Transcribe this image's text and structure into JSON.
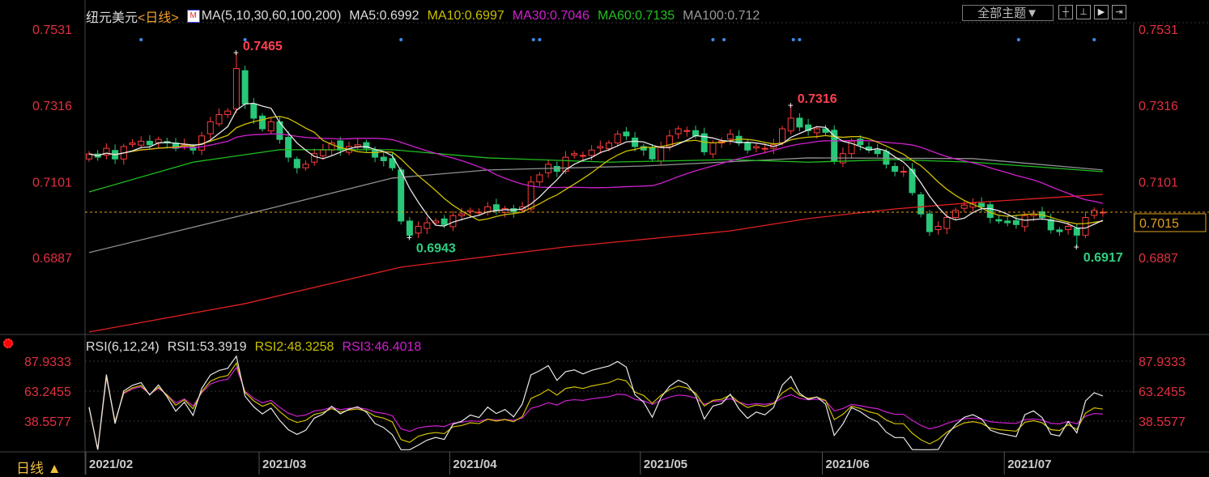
{
  "header": {
    "symbol": "纽元美元",
    "period": "<日线>",
    "ma_label": "MA(5,10,30,60,100,200)",
    "ma5": "MA5:0.6992",
    "ma10": "MA10:0.6997",
    "ma30": "MA30:0.7046",
    "ma60": "MA60:0.7135",
    "ma100": "MA100:0.712",
    "theme_button": "全部主题▼"
  },
  "toolbar_icons": [
    "crosshair-icon",
    "zoom-range-icon",
    "play-icon",
    "move-right-icon"
  ],
  "rsi_header": {
    "label": "RSI(6,12,24)",
    "rsi1": "RSI1:53.3919",
    "rsi2": "RSI2:48.3258",
    "rsi3": "RSI3:46.4018"
  },
  "timeframe": "日线 ▲",
  "colors": {
    "up": "#ff3b3b",
    "down": "#28c878",
    "ma5": "#e8e8e8",
    "ma10": "#d0c000",
    "ma30": "#d020d0",
    "ma60": "#20c020",
    "ma100": "#909090",
    "ma200": "#e02020",
    "axis": "#e03040",
    "last": "#e0a020"
  },
  "chart_data": {
    "type": "candlestick",
    "price_ticks": [
      "0.7531",
      "0.7316",
      "0.7101",
      "0.6887"
    ],
    "price_range": [
      0.6672,
      0.7531
    ],
    "rsi_ticks": [
      "87.9333",
      "63.2455",
      "38.5577"
    ],
    "rsi_range": [
      15,
      95
    ],
    "date_labels": [
      {
        "label": "2021/02",
        "index": 0
      },
      {
        "label": "2021/03",
        "index": 20
      },
      {
        "label": "2021/04",
        "index": 42
      },
      {
        "label": "2021/05",
        "index": 64
      },
      {
        "label": "2021/06",
        "index": 85
      },
      {
        "label": "2021/07",
        "index": 106
      }
    ],
    "closes": [
      0.7179,
      0.717,
      0.7195,
      0.7165,
      0.72,
      0.721,
      0.7215,
      0.7205,
      0.722,
      0.721,
      0.7195,
      0.7205,
      0.719,
      0.723,
      0.727,
      0.729,
      0.73,
      0.742,
      0.732,
      0.728,
      0.725,
      0.727,
      0.722,
      0.717,
      0.714,
      0.715,
      0.718,
      0.719,
      0.721,
      0.719,
      0.72,
      0.7205,
      0.7195,
      0.717,
      0.716,
      0.714,
      0.699,
      0.695,
      0.6975,
      0.6985,
      0.699,
      0.698,
      0.7005,
      0.701,
      0.702,
      0.7015,
      0.703,
      0.702,
      0.7025,
      0.7015,
      0.703,
      0.71,
      0.712,
      0.715,
      0.713,
      0.717,
      0.718,
      0.7175,
      0.719,
      0.72,
      0.721,
      0.7235,
      0.723,
      0.72,
      0.719,
      0.7165,
      0.72,
      0.723,
      0.725,
      0.7245,
      0.723,
      0.7185,
      0.721,
      0.7215,
      0.7235,
      0.721,
      0.719,
      0.72,
      0.7195,
      0.7205,
      0.725,
      0.728,
      0.7255,
      0.7245,
      0.725,
      0.724,
      0.716,
      0.718,
      0.7215,
      0.7205,
      0.719,
      0.718,
      0.715,
      0.713,
      0.713,
      0.707,
      0.701,
      0.696,
      0.6975,
      0.7,
      0.702,
      0.7035,
      0.704,
      0.703,
      0.7,
      0.699,
      0.6985,
      0.698,
      0.7005,
      0.701,
      0.7,
      0.6965,
      0.696,
      0.6975,
      0.695,
      0.7,
      0.702,
      0.7015
    ],
    "first_open": 0.7165,
    "extremes": [
      {
        "index": 17,
        "type": "high",
        "value": 0.7465,
        "label": "0.7465"
      },
      {
        "index": 37,
        "type": "low",
        "value": 0.6943,
        "label": "0.6943"
      },
      {
        "index": 81,
        "type": "high",
        "value": 0.7316,
        "label": "0.7316"
      },
      {
        "index": 114,
        "type": "low",
        "value": 0.6917,
        "label": "0.6917"
      }
    ],
    "ma60": [
      [
        0,
        0.7072
      ],
      [
        12,
        0.7156
      ],
      [
        22,
        0.7191
      ],
      [
        35,
        0.7191
      ],
      [
        46,
        0.7168
      ],
      [
        60,
        0.7156
      ],
      [
        74,
        0.7163
      ],
      [
        83,
        0.7156
      ],
      [
        93,
        0.7163
      ],
      [
        102,
        0.7156
      ],
      [
        117,
        0.7129
      ]
    ],
    "ma100": [
      [
        0,
        0.6901
      ],
      [
        18,
        0.7008
      ],
      [
        35,
        0.7111
      ],
      [
        46,
        0.7134
      ],
      [
        64,
        0.7145
      ],
      [
        83,
        0.7168
      ],
      [
        102,
        0.7166
      ],
      [
        117,
        0.7134
      ]
    ],
    "ma200": [
      [
        0,
        0.6677
      ],
      [
        18,
        0.6757
      ],
      [
        36,
        0.686
      ],
      [
        55,
        0.6917
      ],
      [
        74,
        0.6962
      ],
      [
        83,
        0.6997
      ],
      [
        93,
        0.7024
      ],
      [
        102,
        0.7042
      ],
      [
        117,
        0.7065
      ]
    ],
    "event_markers": [
      6,
      18,
      36,
      51,
      52,
      72,
      73,
      81,
      82,
      107,
      116
    ],
    "last_price": "0.7015"
  }
}
